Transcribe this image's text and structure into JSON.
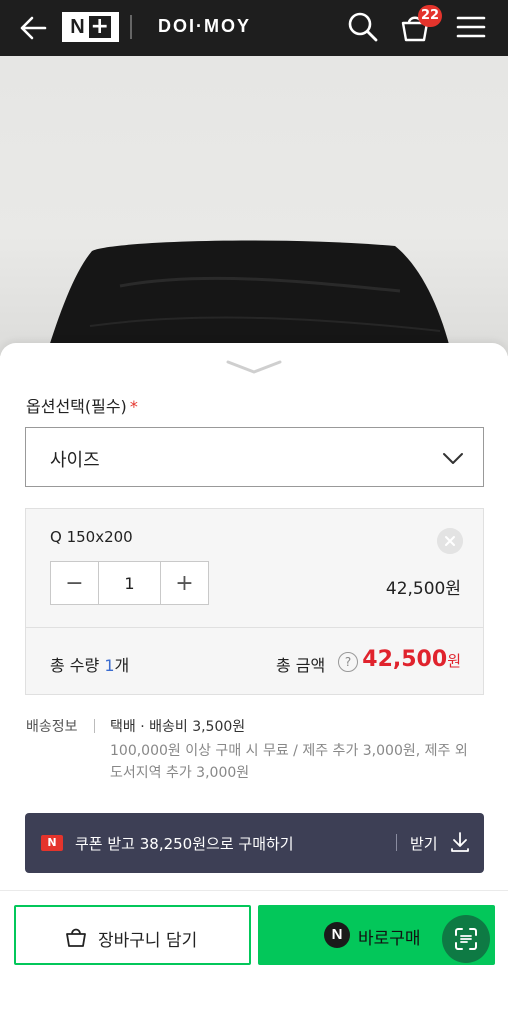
{
  "header": {
    "brand_badge_letter": "N",
    "brand_badge_plus": "+",
    "brand_name": "DOI·MOY",
    "cart_count": "22"
  },
  "option": {
    "label": "옵션선택(필수)",
    "required_mark": "*",
    "select_value": "사이즈"
  },
  "selected_item": {
    "name": "Q 150x200",
    "quantity": "1",
    "decrement": "−",
    "increment": "+",
    "price": "42,500원"
  },
  "summary": {
    "qty_prefix": "총 수량 ",
    "qty_number": "1",
    "qty_suffix": "개",
    "total_label": "총 금액",
    "help": "?",
    "total_amount": "42,500",
    "total_unit": "원"
  },
  "shipping": {
    "label": "배송정보",
    "fee": "택배 · 배송비 3,500원",
    "note": "100,000원 이상 구매 시 무료 / 제주 추가 3,000원, 제주 외 도서지역 추가 3,000원"
  },
  "coupon": {
    "badge": "N",
    "text": "쿠폰 받고 38,250원으로 구매하기",
    "get_label": "받기"
  },
  "actions": {
    "cart_label": "장바구니 담기",
    "buy_badge": "N",
    "buy_label": "바로구매"
  },
  "colors": {
    "header_bg": "#1e1e1e",
    "accent_green": "#03c75a",
    "price_red": "#e0232d",
    "badge_red": "#e4342c",
    "coupon_bg": "#3d3f55"
  }
}
